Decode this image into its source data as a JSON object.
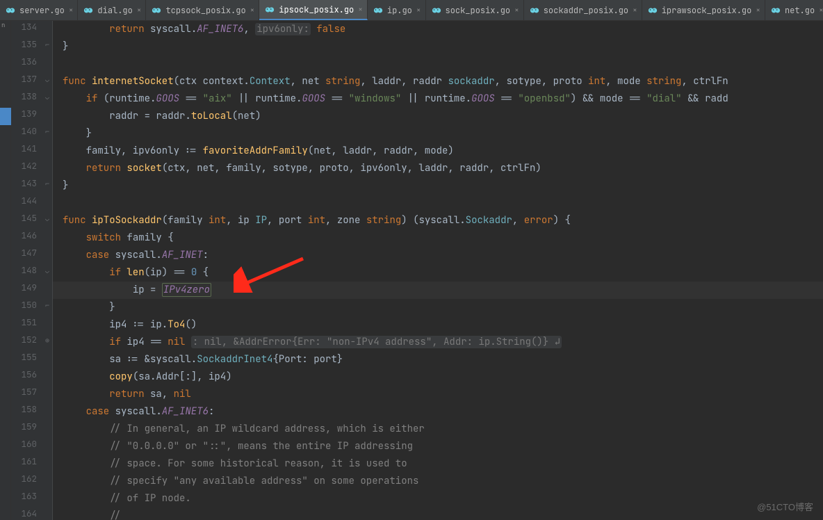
{
  "tabs": [
    {
      "label": "server.go",
      "active": false
    },
    {
      "label": "dial.go",
      "active": false
    },
    {
      "label": "tcpsock_posix.go",
      "active": false
    },
    {
      "label": "ipsock_posix.go",
      "active": true
    },
    {
      "label": "ip.go",
      "active": false
    },
    {
      "label": "sock_posix.go",
      "active": false
    },
    {
      "label": "sockaddr_posix.go",
      "active": false
    },
    {
      "label": "iprawsock_posix.go",
      "active": false
    },
    {
      "label": "net.go",
      "active": false
    }
  ],
  "left_rail_stub": "n",
  "line_numbers": [
    "134",
    "135",
    "136",
    "137",
    "138",
    "139",
    "140",
    "141",
    "142",
    "143",
    "144",
    "145",
    "146",
    "147",
    "148",
    "149",
    "150",
    "151",
    "152",
    "155",
    "156",
    "157",
    "158",
    "159",
    "160",
    "161",
    "162",
    "163",
    "164"
  ],
  "code": {
    "l134": {
      "p": "        ",
      "t1": "return ",
      "t2": "syscall",
      "t3": ".",
      "t4": "AF_INET6",
      "t5": ", ",
      "hint": "ipv6only:",
      "t6": " false"
    },
    "l135": {
      "p": "",
      "t": "}"
    },
    "l137": {
      "kw": "func ",
      "fn": "internetSocket",
      "sig1": "(ctx context.",
      "ty": "Context",
      "sig2": ", net ",
      "ty2": "string",
      "sig3": ", laddr, raddr ",
      "ty3": "sockaddr",
      "sig4": ", sotype, proto ",
      "ty4": "int",
      "sig5": ", mode ",
      "ty5": "string",
      "sig6": ", ctrlFn"
    },
    "l138": {
      "p": "    ",
      "kw": "if ",
      "t1": "(runtime.",
      "c1": "GOOS",
      "t2": " == ",
      "s1": "\"aix\"",
      "t3": " || runtime.",
      "c2": "GOOS",
      "t4": " == ",
      "s2": "\"windows\"",
      "t5": " || runtime.",
      "c3": "GOOS",
      "t6": " == ",
      "s3": "\"openbsd\"",
      "t7": ") && mode == ",
      "s4": "\"dial\"",
      "t8": " && radd"
    },
    "l139": {
      "p": "        ",
      "t": "raddr = raddr.",
      "fn": "toLocal",
      "t2": "(net)"
    },
    "l140": {
      "p": "    ",
      "t": "}"
    },
    "l141": {
      "p": "    ",
      "t1": "family, ipv6only := ",
      "fn": "favoriteAddrFamily",
      "t2": "(net, laddr, raddr, mode)"
    },
    "l142": {
      "p": "    ",
      "kw": "return ",
      "fn": "socket",
      "t": "(ctx, net, family, sotype, proto, ipv6only, laddr, raddr, ctrlFn)"
    },
    "l143": {
      "t": "}"
    },
    "l145": {
      "kw": "func ",
      "fn": "ipToSockaddr",
      "t1": "(family ",
      "ty1": "int",
      "t2": ", ip ",
      "ty2": "IP",
      "t3": ", port ",
      "ty3": "int",
      "t4": ", zone ",
      "ty4": "string",
      "t5": ") (syscall.",
      "ty5": "Sockaddr",
      "t6": ", ",
      "ty6": "error",
      "t7": ") {"
    },
    "l146": {
      "p": "    ",
      "kw": "switch ",
      "t": "family {"
    },
    "l147": {
      "p": "    ",
      "kw": "case ",
      "t1": "syscall.",
      "c": "AF_INET",
      "t2": ":"
    },
    "l148": {
      "p": "        ",
      "kw": "if ",
      "fn": "len",
      "t1": "(ip) == ",
      "nu": "0",
      "t2": " {"
    },
    "l149": {
      "p": "            ",
      "t1": "ip = ",
      "v": "IPv4zero"
    },
    "l150": {
      "p": "        ",
      "t": "}"
    },
    "l151": {
      "p": "        ",
      "t1": "ip4 := ip.",
      "fn": "To4",
      "t2": "()"
    },
    "l152": {
      "p": "        ",
      "kw": "if ",
      "t1": "ip4 == ",
      "nil": "nil ",
      "hint": ": nil, &AddrError{Err: \"non-IPv4 address\", Addr: ip.String()} ↲"
    },
    "l155": {
      "p": "        ",
      "t1": "sa := &syscall.",
      "ty": "SockaddrInet4",
      "t2": "{Port: port}"
    },
    "l156": {
      "p": "        ",
      "fn": "copy",
      "t": "(sa.Addr[:], ip4)"
    },
    "l157": {
      "p": "        ",
      "kw": "return ",
      "t1": "sa, ",
      "nil": "nil"
    },
    "l158": {
      "p": "    ",
      "kw": "case ",
      "t1": "syscall.",
      "c": "AF_INET6",
      "t2": ":"
    },
    "l159": {
      "p": "        ",
      "cm": "// In general, an IP wildcard address, which is either"
    },
    "l160": {
      "p": "        ",
      "cm": "// \"0.0.0.0\" or \"::\", means the entire IP addressing"
    },
    "l161": {
      "p": "        ",
      "cm": "// space. For some historical reason, it is used to"
    },
    "l162": {
      "p": "        ",
      "cm": "// specify \"any available address\" on some operations"
    },
    "l163": {
      "p": "        ",
      "cm": "// of IP node."
    },
    "l164": {
      "p": "        ",
      "cm": "//"
    }
  },
  "watermark": "@51CTO博客"
}
